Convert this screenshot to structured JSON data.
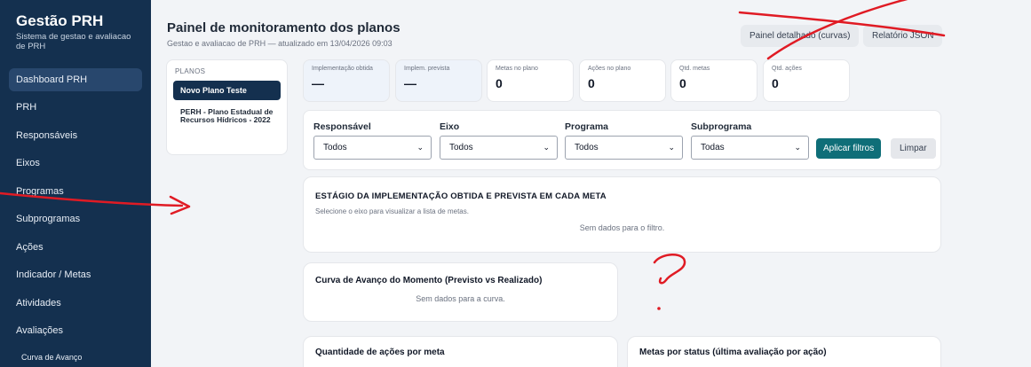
{
  "sidebar": {
    "brand_title": "Gestão PRH",
    "brand_subtitle": "Sistema de gestao e avaliacao de PRH",
    "items": [
      {
        "label": "Dashboard PRH",
        "active": true
      },
      {
        "label": "PRH"
      },
      {
        "label": "Responsáveis"
      },
      {
        "label": "Eixos"
      },
      {
        "label": "Programas"
      },
      {
        "label": "Subprogramas"
      },
      {
        "label": "Ações"
      },
      {
        "label": "Indicador / Metas"
      },
      {
        "label": "Atividades"
      },
      {
        "label": "Avaliações"
      }
    ],
    "sub_items": [
      {
        "label": "Curva de Avanço"
      }
    ]
  },
  "header": {
    "title": "Painel de monitoramento dos planos",
    "subtitle": "Gestao e avaliacao de PRH — atualizado em 13/04/2026 09:03",
    "btn_detail": "Painel detalhado (curvas)",
    "btn_json": "Relatório JSON"
  },
  "plans": {
    "label": "PLANOS",
    "active": "Novo Plano Teste",
    "other": "PERH - Plano Estadual de Recursos Hídricos - 2022"
  },
  "kpis": [
    {
      "label": "Implementação obtida",
      "value": "—"
    },
    {
      "label": "Implem. prevista",
      "value": "—"
    },
    {
      "label": "Metas no plano",
      "value": "0"
    },
    {
      "label": "Ações no plano",
      "value": "0"
    },
    {
      "label": "Qtd. metas",
      "value": "0"
    },
    {
      "label": "Qtd. ações",
      "value": "0"
    }
  ],
  "filters": {
    "responsavel": {
      "label": "Responsável",
      "value": "Todos"
    },
    "eixo": {
      "label": "Eixo",
      "value": "Todos"
    },
    "programa": {
      "label": "Programa",
      "value": "Todos"
    },
    "subprograma": {
      "label": "Subprograma",
      "value": "Todas"
    },
    "apply": "Aplicar filtros",
    "clear": "Limpar"
  },
  "stage_card": {
    "title": "ESTÁGIO DA IMPLEMENTAÇÃO OBTIDA E PREVISTA EM CADA META",
    "subtitle": "Selecione o eixo para visualizar a lista de metas.",
    "empty": "Sem dados para o filtro."
  },
  "curve_card": {
    "title": "Curva de Avanço do Momento (Previsto vs Realizado)",
    "empty": "Sem dados para a curva."
  },
  "qty_card": {
    "title": "Quantidade de ações por meta"
  },
  "status_card": {
    "title": "Metas por status (última avaliação por ação)"
  },
  "annotation_color": "#e01b24",
  "icons": {
    "dropdown": "chevron-down-icon"
  }
}
